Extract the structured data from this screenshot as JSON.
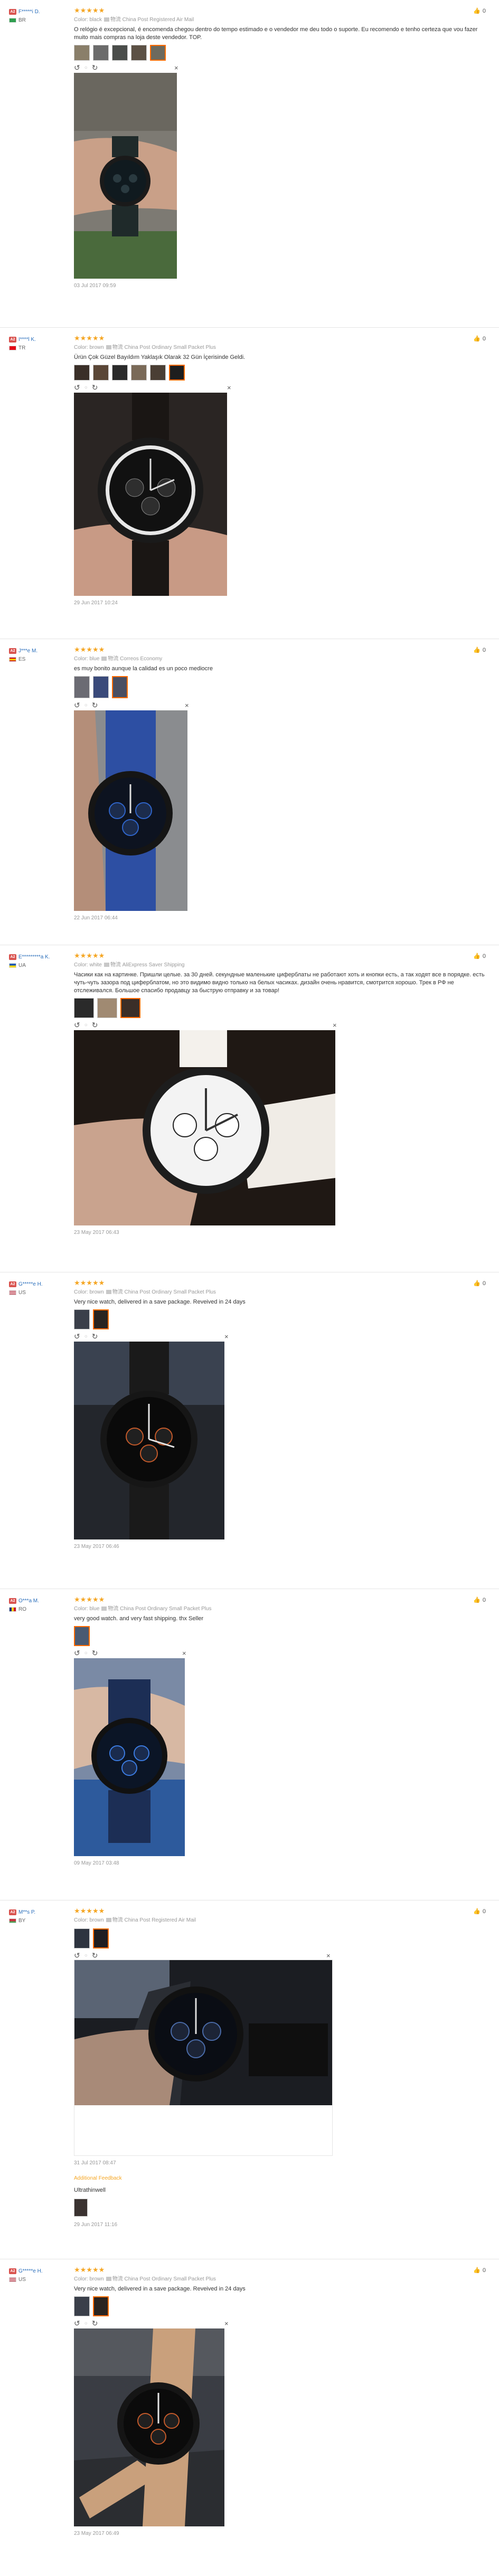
{
  "reviews": [
    {
      "user": "F*****i D.",
      "country": "BR",
      "stars": "★★★★★",
      "color_label": "Color:",
      "color_value": "black",
      "logistics": "China Post Registered Air Mail",
      "text": "O relógio é excepcional, é encomenda chegou dentro do tempo estimado e o vendedor me deu todo o suporte. Eu recomendo e tenho certeza que vou fazer muito mais compras na loja deste vendedor. TOP.",
      "date": "03 Jul 2017 09:59",
      "helpful": "0"
    },
    {
      "user": "I****l K.",
      "country": "TR",
      "stars": "★★★★★",
      "color_label": "Color:",
      "color_value": "brown",
      "logistics": "China Post Ordinary Small Packet Plus",
      "text": "Ürün Çok Güzel Bayıldım Yaklaşık Olarak 32 Gün İçerisinde Geldi.",
      "date": "29 Jun 2017 10:24",
      "helpful": "0"
    },
    {
      "user": "J***e M.",
      "country": "ES",
      "stars": "★★★★★",
      "color_label": "Color:",
      "color_value": "blue",
      "logistics": "Correos Economy",
      "text": "es muy bonito aunque la calidad es un poco mediocre",
      "date": "22 Jun 2017 06:44",
      "helpful": "0"
    },
    {
      "user": "E*********a K.",
      "country": "UA",
      "stars": "★★★★★",
      "color_label": "Color:",
      "color_value": "white",
      "logistics": "AliExpress Saver Shipping",
      "text": "Часики как на картинке. Пришли целые. за 30 дней. секундные маленькие циферблаты не работают хоть и кнопки есть, а так ходят все в порядке. есть чуть-чуть зазора под циферблатом, но это видимо видно только на белых часиках. дизайн очень нравится, смотрится хорошо. Трек в РФ не отслеживался. Большое спасибо продавцу за быструю отправку и за товар!",
      "date": "23 May 2017 06:43",
      "helpful": "0"
    },
    {
      "user": "G*****e H.",
      "country": "US",
      "stars": "★★★★★",
      "color_label": "Color:",
      "color_value": "brown",
      "logistics": "China Post Ordinary Small Packet Plus",
      "text": "Very nice watch, delivered in a save package. Reveived in 24 days",
      "date": "23 May 2017 06:46",
      "helpful": "0"
    },
    {
      "user": "O***a M.",
      "country": "RO",
      "stars": "★★★★★",
      "color_label": "Color:",
      "color_value": "blue",
      "logistics": "China Post Ordinary Small Packet Plus",
      "text": "very good watch. and very fast shipping. thx Seller",
      "date": "09 May 2017 03:48",
      "helpful": "0"
    },
    {
      "user": "M**s P.",
      "country": "BY",
      "stars": "★★★★★",
      "color_label": "Color:",
      "color_value": "brown",
      "logistics": "China Post Registered Air Mail",
      "text": "",
      "date": "31 Jul 2017 08:47",
      "helpful": "0",
      "additional_label": "Additional Feedback",
      "additional_text": "Ultrathinwell",
      "additional_date": "29 Jun 2017 11:16"
    },
    {
      "user": "G*****e H.",
      "country": "US",
      "stars": "★★★★★",
      "color_label": "Color:",
      "color_value": "brown",
      "logistics": "China Post Ordinary Small Packet Plus",
      "text": "Very nice watch, delivered in a save package. Reveived in 24 days",
      "date": "23 May 2017 06:49",
      "helpful": "0"
    }
  ],
  "level_badge": "A2",
  "logistics_prefix": "物流",
  "colors": {
    "star": "#f5a623",
    "username": "#2a6ebb",
    "active_thumb": "#ff6a00"
  }
}
